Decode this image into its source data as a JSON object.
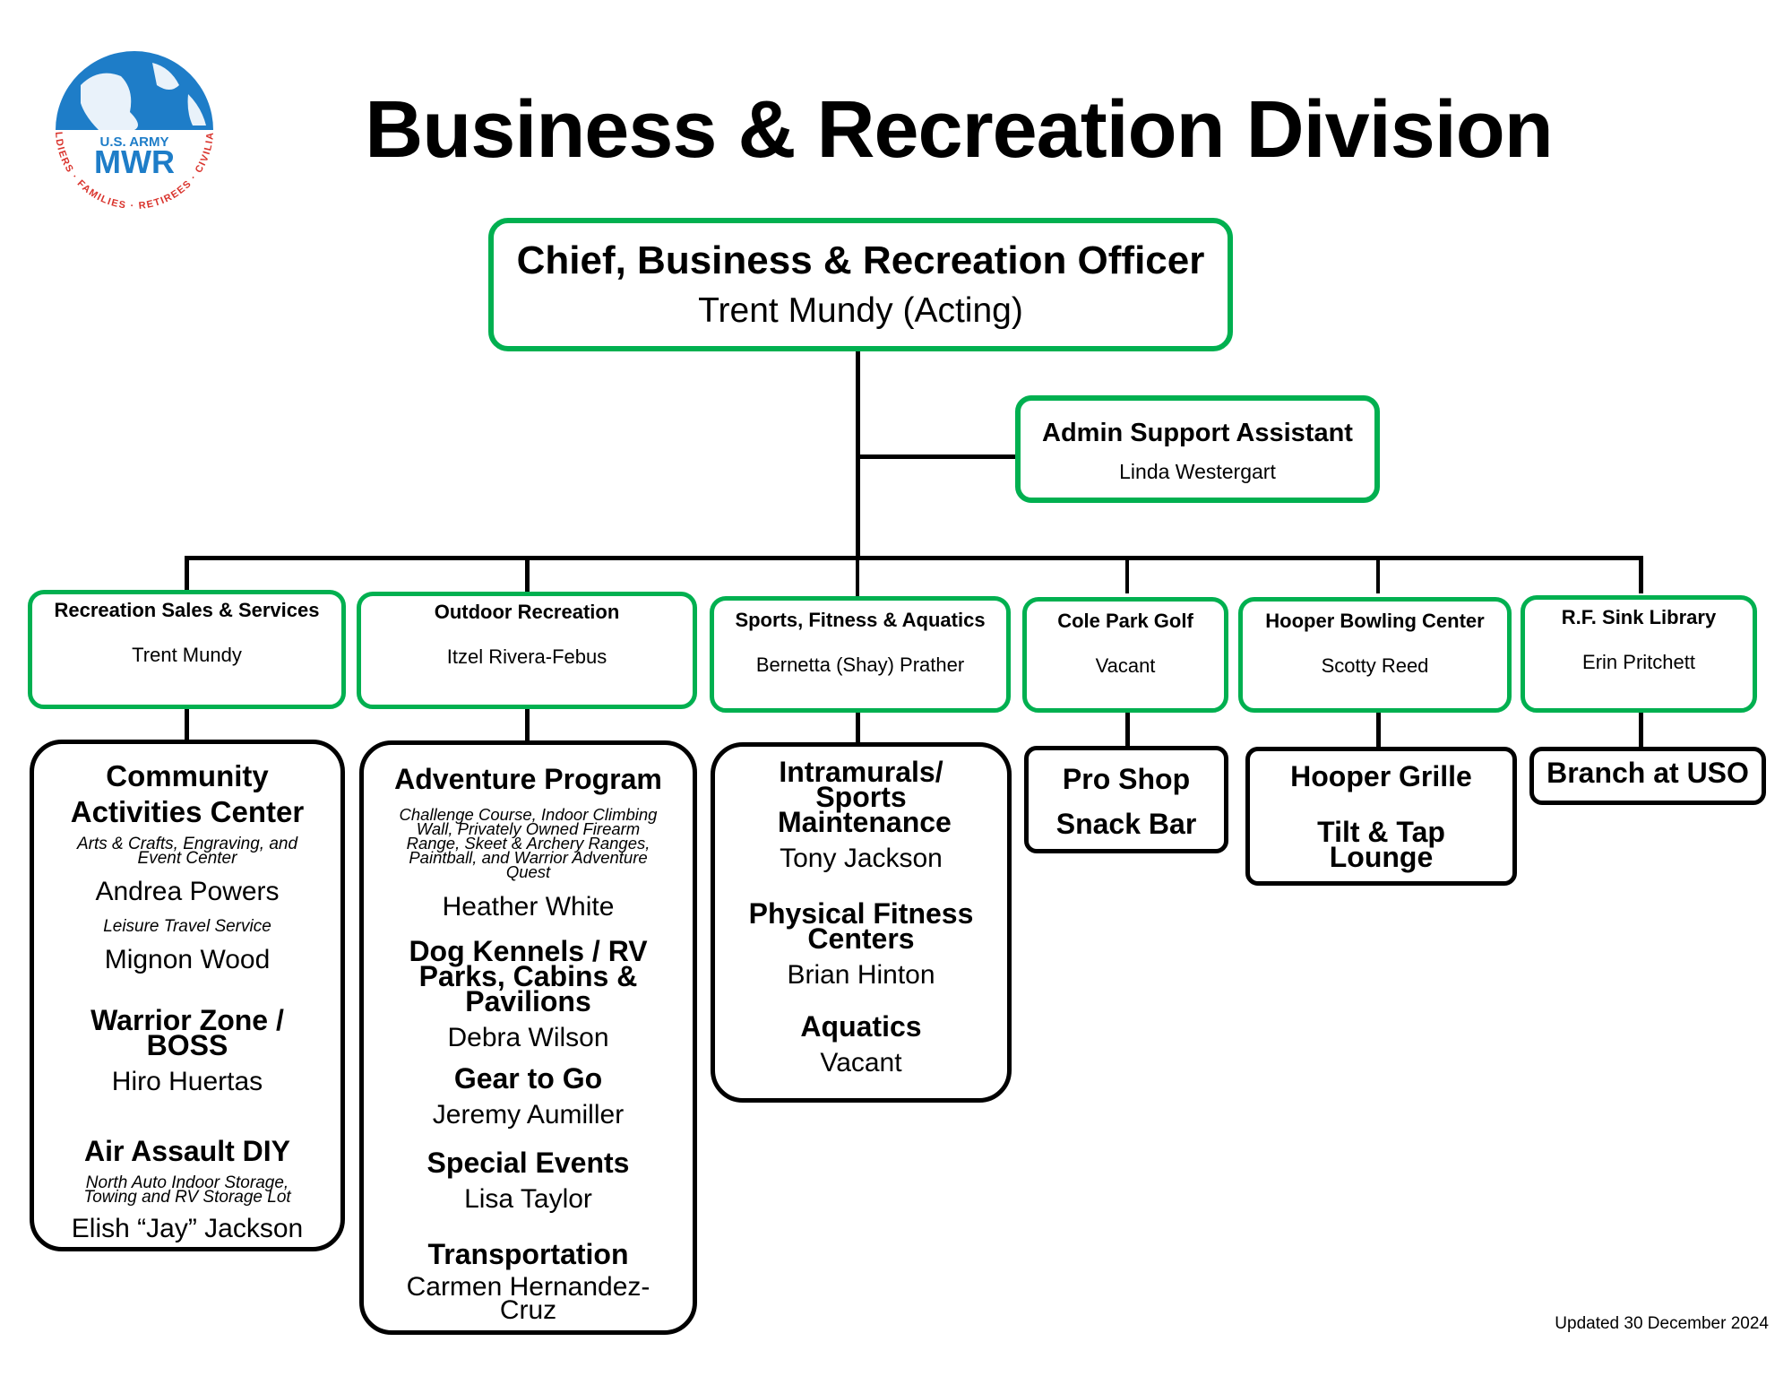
{
  "logo": {
    "line1": "U.S. ARMY",
    "line2": "MWR",
    "ring_text": "SOLDIERS · FAMILIES · RETIREES · CIVILIANS",
    "colors": {
      "globe": "#1E7DC8",
      "ring_text": "#D9322B"
    }
  },
  "title": "Business & Recreation Division",
  "chief": {
    "title": "Chief, Business & Recreation Officer",
    "name": "Trent Mundy (Acting)"
  },
  "admin": {
    "title": "Admin Support Assistant",
    "name": "Linda Westergart"
  },
  "colors": {
    "division_border": "#00B050",
    "program_border": "#000000"
  },
  "divisions": [
    {
      "title": "Recreation Sales & Services",
      "name": "Trent Mundy"
    },
    {
      "title": "Outdoor Recreation",
      "name": "Itzel Rivera-Febus"
    },
    {
      "title": "Sports, Fitness & Aquatics",
      "name": "Bernetta (Shay) Prather"
    },
    {
      "title": "Cole Park Golf",
      "name": "Vacant"
    },
    {
      "title": "Hooper Bowling Center",
      "name": "Scotty Reed"
    },
    {
      "title": "R.F. Sink Library",
      "name": "Erin Pritchett"
    }
  ],
  "programs": {
    "rss": {
      "cac_title": "Community Activities Center",
      "cac_note": "Arts & Crafts, Engraving, and Event Center",
      "cac_person": "Andrea Powers",
      "travel_note": "Leisure Travel Service",
      "travel_person": "Mignon Wood",
      "wz_title": "Warrior Zone / BOSS",
      "wz_person": "Hiro Huertas",
      "diy_title": "Air Assault DIY",
      "diy_note": "North Auto Indoor Storage, Towing and RV Storage Lot",
      "diy_person": "Elish “Jay” Jackson"
    },
    "odr": {
      "adv_title": "Adventure Program",
      "adv_note": "Challenge Course, Indoor Climbing Wall, Privately Owned Firearm Range, Skeet & Archery Ranges, Paintball, and Warrior Adventure Quest",
      "adv_person": "Heather White",
      "dog_title": "Dog Kennels / RV Parks, Cabins & Pavilions",
      "dog_person": "Debra Wilson",
      "gear_title": "Gear to Go",
      "gear_person": "Jeremy Aumiller",
      "se_title": "Special Events",
      "se_person": "Lisa Taylor",
      "tr_title": "Transportation",
      "tr_person": "Carmen Hernandez-Cruz"
    },
    "sfa": {
      "im_title": "Intramurals/ Sports Maintenance",
      "im_person": "Tony Jackson",
      "pf_title": "Physical Fitness Centers",
      "pf_person": "Brian Hinton",
      "aq_title": "Aquatics",
      "aq_person": "Vacant"
    },
    "golf": {
      "item1": "Pro Shop",
      "item2": "Snack Bar"
    },
    "bowling": {
      "item1": "Hooper Grille",
      "item2": "Tilt & Tap Lounge"
    },
    "library": {
      "item1": "Branch at USO"
    }
  },
  "footer": {
    "updated": "Updated 30 December 2024"
  }
}
